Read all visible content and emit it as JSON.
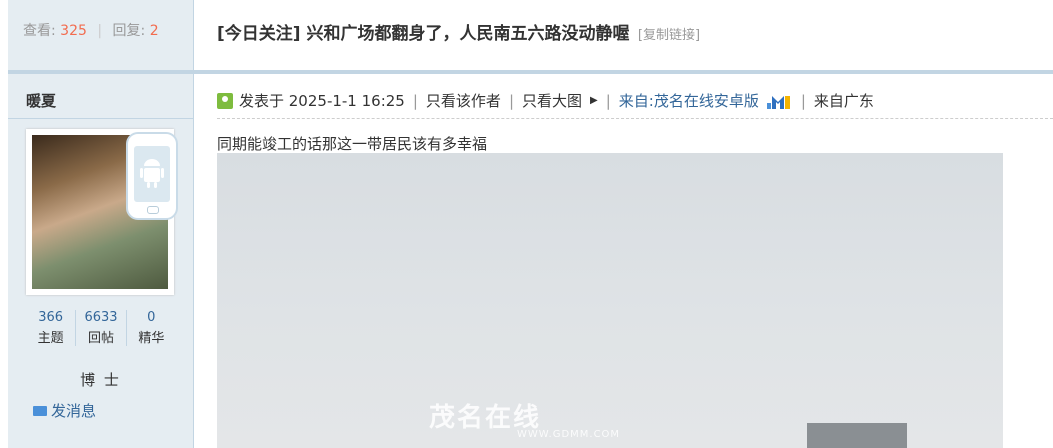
{
  "stats": {
    "views_label": "查看:",
    "views": "325",
    "replies_label": "回复:",
    "replies": "2"
  },
  "thread": {
    "title": "[今日关注] 兴和广场都翻身了，人民南五六路没动静喔",
    "copy_link": "[复制链接]"
  },
  "author": {
    "name": "暖夏",
    "counts": [
      {
        "value": "366",
        "label": "主题"
      },
      {
        "value": "6633",
        "label": "回帖"
      },
      {
        "value": "0",
        "label": "精华"
      }
    ],
    "rank": "博 士",
    "send_message": "发消息"
  },
  "post": {
    "posted_label": "发表于 2025-1-1 16:25",
    "only_author": "只看该作者",
    "large_image": "只看大图",
    "source": "来自:茂名在线安卓版",
    "location": "来自广东",
    "content": "同期能竣工的话那这一带居民该有多幸福",
    "watermark": "茂名在线",
    "watermark_url": "WWW.GDMM.COM"
  },
  "colors": {
    "accent": "#336699",
    "count_red": "#f26c4f",
    "sidebar_bg": "#e5edf2",
    "border": "#c2d5e3"
  },
  "icons": {
    "poster": "user-icon",
    "mail": "mail-icon",
    "android": "android-phone-icon",
    "arrow": "triangle-right-icon",
    "app": "m-app-logo-icon"
  }
}
